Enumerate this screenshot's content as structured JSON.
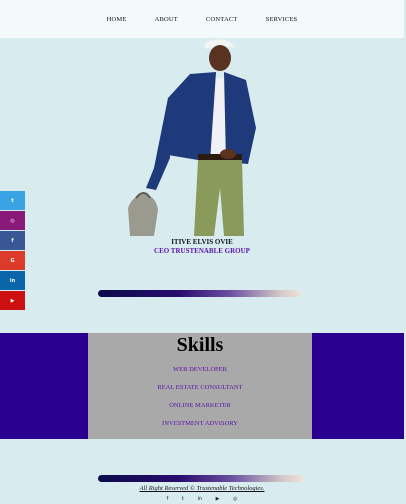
{
  "nav": {
    "items": [
      "HOME",
      "ABOUT",
      "CONTACT",
      "SERVICES"
    ]
  },
  "profile": {
    "name": "ITIVE ELVIS OVIE",
    "title": "CEO TRUSTENABLE GROUP"
  },
  "skills": {
    "heading": "Skills",
    "items": [
      "WEB DEVELOPER",
      "REAL ESTATE CONSULTANT",
      "ONLINE MARKETER",
      "INVESTMENT ADVISORY"
    ]
  },
  "social_sidebar": [
    {
      "icon": "twitter-icon",
      "glyph": "t",
      "color": "#3aa3e3"
    },
    {
      "icon": "instagram-icon",
      "glyph": "◎",
      "color": "#8a1a7a"
    },
    {
      "icon": "facebook-icon",
      "glyph": "f",
      "color": "#3a5795"
    },
    {
      "icon": "google-plus-icon",
      "glyph": "G",
      "color": "#dc3a2a"
    },
    {
      "icon": "linkedin-icon",
      "glyph": "in",
      "color": "#0a66a8"
    },
    {
      "icon": "youtube-icon",
      "glyph": "▶",
      "color": "#cc1010"
    }
  ],
  "footer": {
    "copyright": "All Right Reserved © Trustenable Technologies.",
    "icons": [
      "facebook-icon",
      "twitter-icon",
      "linkedin-icon",
      "youtube-icon",
      "instagram-icon"
    ]
  }
}
